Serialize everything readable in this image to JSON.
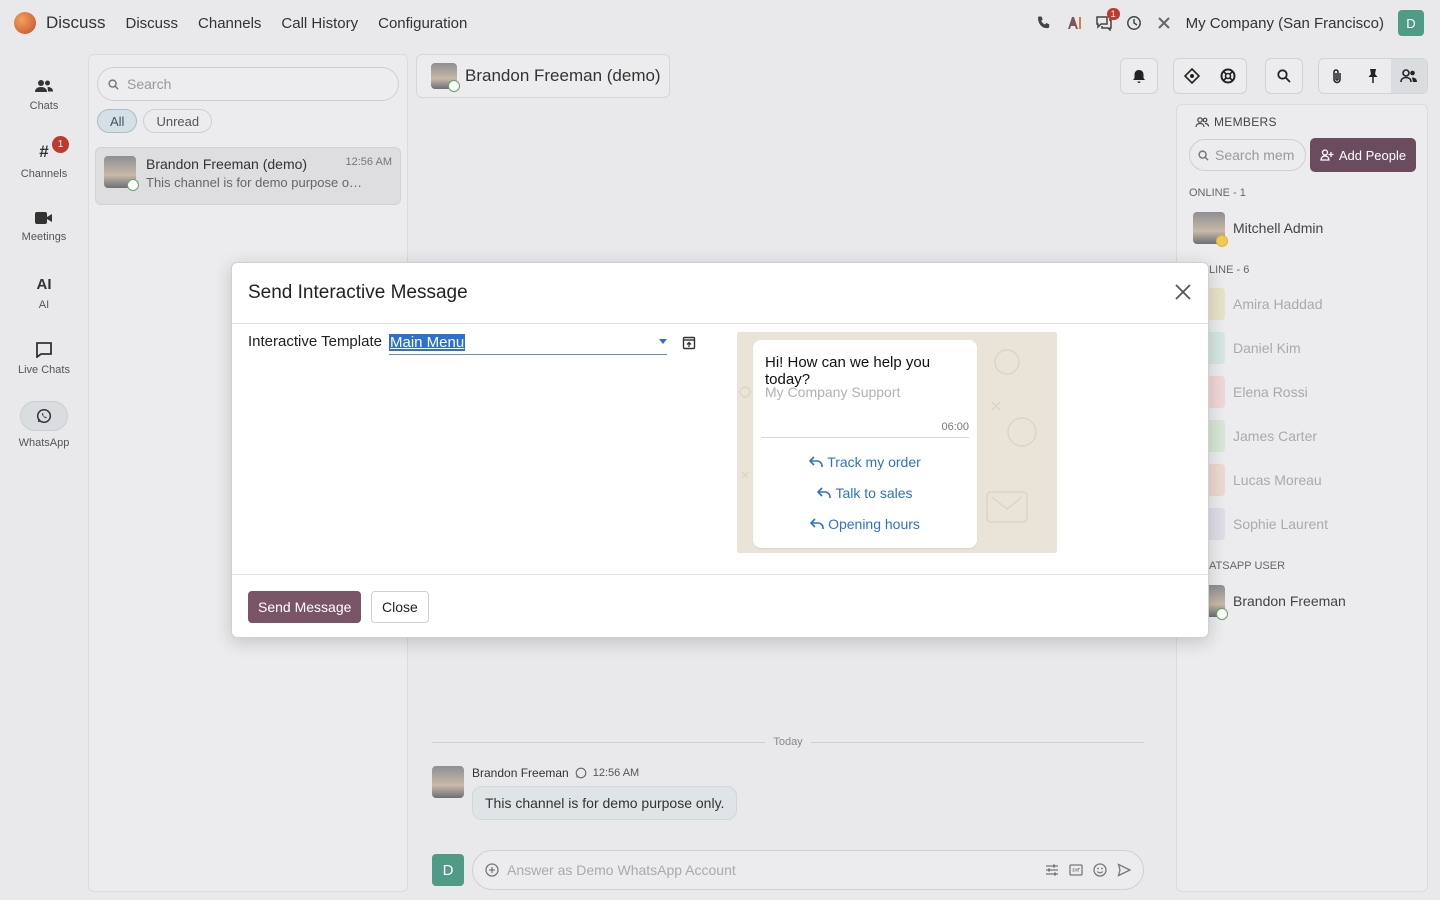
{
  "topbar": {
    "app_name": "Discuss",
    "menu": [
      "Discuss",
      "Channels",
      "Call History",
      "Configuration"
    ],
    "company": "My Company (San Francisco)",
    "user_initial": "D",
    "messages_badge": "1"
  },
  "rail": {
    "chats": "Chats",
    "channels": "Channels",
    "channels_badge": "1",
    "meetings": "Meetings",
    "ai": "AI",
    "live_chats": "Live Chats",
    "whatsapp": "WhatsApp"
  },
  "sidebar": {
    "search_placeholder": "Search",
    "filter_all": "All",
    "filter_unread": "Unread",
    "conversation": {
      "name": "Brandon Freeman (demo)",
      "time": "12:56 AM",
      "preview": "This channel is for demo purpose o…"
    }
  },
  "thread": {
    "title": "Brandon Freeman (demo)",
    "day_separator": "Today",
    "message": {
      "author": "Brandon Freeman",
      "time": "12:56 AM",
      "text": "This channel is for demo purpose only."
    },
    "composer_initial": "D",
    "composer_placeholder": "Answer as Demo WhatsApp Account"
  },
  "members": {
    "title": "MEMBERS",
    "search_placeholder": "Search mem",
    "add_people": "Add People",
    "online_label": "ONLINE - 1",
    "offline_label": "LINE - 6",
    "whatsapp_label": "ATSAPP USER",
    "online": [
      "Mitchell Admin"
    ],
    "offline": [
      "Amira Haddad",
      "Daniel Kim",
      "Elena Rossi",
      "James Carter",
      "Lucas Moreau",
      "Sophie Laurent"
    ],
    "whatsapp_user": "Brandon Freeman"
  },
  "modal": {
    "title": "Send Interactive Message",
    "field_label": "Interactive Template",
    "template_value": "Main Menu",
    "preview": {
      "body": "Hi! How can we help you today?",
      "footer": "My Company Support",
      "time": "06:00",
      "buttons": [
        "Track my order",
        "Talk to sales",
        "Opening hours"
      ]
    },
    "send_button": "Send Message",
    "close_button": "Close"
  },
  "colors": {
    "primary": "#7a5467",
    "add_people": "#6b4b5e",
    "accent_link": "#2a73c9",
    "badge": "#c0392b",
    "avatar_green": "#4f9b86"
  }
}
